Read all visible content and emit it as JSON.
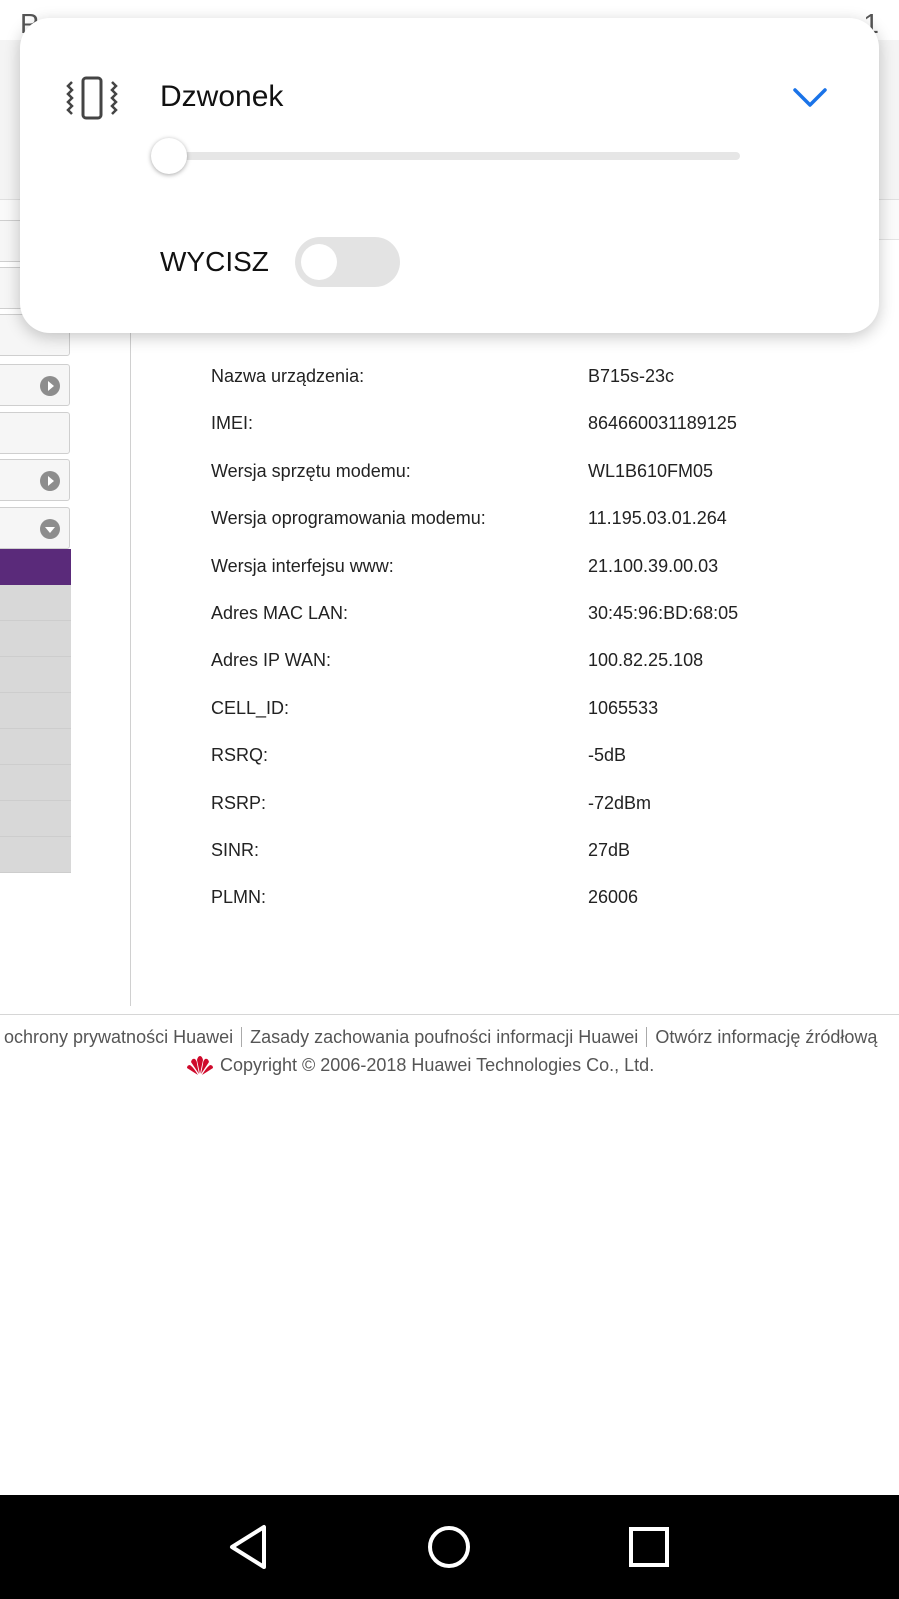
{
  "status_bar": {
    "left_text": "P",
    "right_text": "1"
  },
  "volume_panel": {
    "title": "Dzwonek",
    "level": 0,
    "mute_label": "WYCISZ",
    "mute_on": false,
    "icons": {
      "mode": "vibrate-icon",
      "expand": "chevron-down-icon"
    },
    "accent": "#1a73e8"
  },
  "info": {
    "rows": [
      {
        "label": "Nazwa urządzenia:",
        "value": "B715s-23c"
      },
      {
        "label": "IMEI:",
        "value": "864660031189125"
      },
      {
        "label": "Wersja sprzętu modemu:",
        "value": "WL1B610FM05"
      },
      {
        "label": "Wersja oprogramowania modemu:",
        "value": "11.195.03.01.264"
      },
      {
        "label": "Wersja interfejsu www:",
        "value": "21.100.39.00.03"
      },
      {
        "label": "Adres MAC LAN:",
        "value": "30:45:96:BD:68:05"
      },
      {
        "label": "Adres IP WAN:",
        "value": "100.82.25.108"
      },
      {
        "label": "CELL_ID:",
        "value": "1065533"
      },
      {
        "label": "RSRQ:",
        "value": "-5dB"
      },
      {
        "label": "RSRP:",
        "value": "-72dBm"
      },
      {
        "label": "SINR:",
        "value": "27dB"
      },
      {
        "label": "PLMN:",
        "value": "26006"
      }
    ]
  },
  "footer": {
    "link1": "ochrony prywatności Huawei",
    "link2": "Zasady zachowania poufności informacji Huawei",
    "link3": "Otwórz informację źródłową",
    "copyright": "Copyright © 2006-2018 Huawei Technologies Co., Ltd."
  },
  "nav": {
    "back": "back-icon",
    "home": "home-icon",
    "recents": "recents-icon"
  },
  "colors": {
    "menu_active": "#5a2a7a",
    "logo": "#cf0a2c"
  }
}
